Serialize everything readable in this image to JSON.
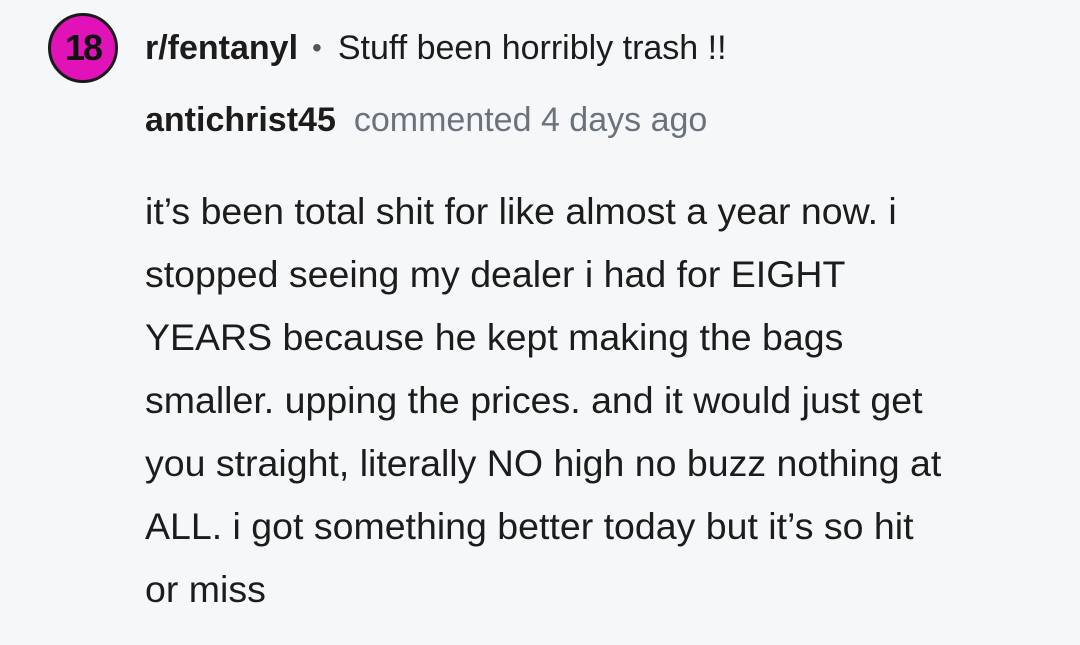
{
  "post": {
    "rank": "18",
    "subreddit": "r/fentanyl",
    "separator": "•",
    "title": "Stuff been horribly trash !!"
  },
  "comment": {
    "author": "antichrist45",
    "action": "commented 4 days ago",
    "lines": [
      "it’s been total shit for like almost a year now. i",
      "stopped seeing my dealer i had for EIGHT",
      "YEARS because he kept making the bags",
      "smaller. upping the prices. and it would just get",
      "you straight, literally NO high no buzz nothing at",
      "ALL. i got something better today but it’s so hit",
      "or miss"
    ]
  },
  "colors": {
    "background": "#f6f7f8",
    "avatar_fill": "#e112b7",
    "text_primary": "#1c1c1c",
    "text_meta": "#6a737c"
  }
}
